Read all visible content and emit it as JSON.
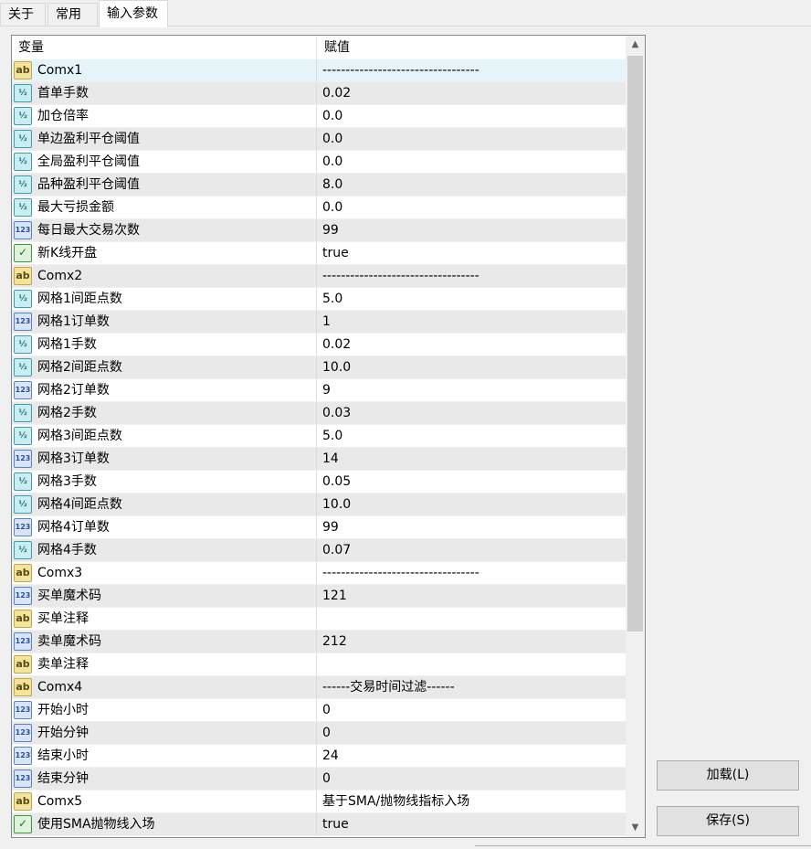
{
  "tabs": [
    {
      "label": "关于"
    },
    {
      "label": "常用"
    },
    {
      "label": "输入参数"
    }
  ],
  "grid": {
    "headers": {
      "variable": "变量",
      "value": "赋值"
    },
    "rows": [
      {
        "type": "ab",
        "name": "Comx1",
        "value": "----------------------------------"
      },
      {
        "type": "dbl",
        "name": "首单手数",
        "value": "0.02"
      },
      {
        "type": "dbl",
        "name": "加仓倍率",
        "value": "0.0"
      },
      {
        "type": "dbl",
        "name": "单边盈利平仓阈值",
        "value": "0.0"
      },
      {
        "type": "dbl",
        "name": "全局盈利平仓阈值",
        "value": "0.0"
      },
      {
        "type": "dbl",
        "name": "品种盈利平仓阈值",
        "value": "8.0"
      },
      {
        "type": "dbl",
        "name": "最大亏损金额",
        "value": "0.0"
      },
      {
        "type": "int",
        "name": "每日最大交易次数",
        "value": "99"
      },
      {
        "type": "bool",
        "name": "新K线开盘",
        "value": "true"
      },
      {
        "type": "ab",
        "name": "Comx2",
        "value": "----------------------------------"
      },
      {
        "type": "dbl",
        "name": "网格1间距点数",
        "value": "5.0"
      },
      {
        "type": "int",
        "name": "网格1订单数",
        "value": "1"
      },
      {
        "type": "dbl",
        "name": "网格1手数",
        "value": "0.02"
      },
      {
        "type": "dbl",
        "name": "网格2间距点数",
        "value": "10.0"
      },
      {
        "type": "int",
        "name": "网格2订单数",
        "value": "9"
      },
      {
        "type": "dbl",
        "name": "网格2手数",
        "value": "0.03"
      },
      {
        "type": "dbl",
        "name": "网格3间距点数",
        "value": "5.0"
      },
      {
        "type": "int",
        "name": "网格3订单数",
        "value": "14"
      },
      {
        "type": "dbl",
        "name": "网格3手数",
        "value": "0.05"
      },
      {
        "type": "dbl",
        "name": "网格4间距点数",
        "value": "10.0"
      },
      {
        "type": "int",
        "name": "网格4订单数",
        "value": "99"
      },
      {
        "type": "dbl",
        "name": "网格4手数",
        "value": "0.07"
      },
      {
        "type": "ab",
        "name": "Comx3",
        "value": "----------------------------------"
      },
      {
        "type": "int",
        "name": "买单魔术码",
        "value": "121"
      },
      {
        "type": "ab",
        "name": "买单注释",
        "value": ""
      },
      {
        "type": "int",
        "name": "卖单魔术码",
        "value": "212"
      },
      {
        "type": "ab",
        "name": "卖单注释",
        "value": ""
      },
      {
        "type": "ab",
        "name": "Comx4",
        "value": "------交易时间过滤------"
      },
      {
        "type": "int",
        "name": "开始小时",
        "value": "0"
      },
      {
        "type": "int",
        "name": "开始分钟",
        "value": "0"
      },
      {
        "type": "int",
        "name": "结束小时",
        "value": "24"
      },
      {
        "type": "int",
        "name": "结束分钟",
        "value": "0"
      },
      {
        "type": "ab",
        "name": "Comx5",
        "value": "基于SMA/抛物线指标入场"
      },
      {
        "type": "bool",
        "name": "使用SMA抛物线入场",
        "value": "true"
      }
    ]
  },
  "buttons": {
    "load": "加载(L)",
    "save": "保存(S)"
  },
  "icon_glyphs": {
    "ab": "ab",
    "dbl": "½",
    "int": "123",
    "bool": "✓"
  },
  "colors": {
    "selected_row": "#e5f3fb",
    "alt_row": "#e9e9e9"
  }
}
